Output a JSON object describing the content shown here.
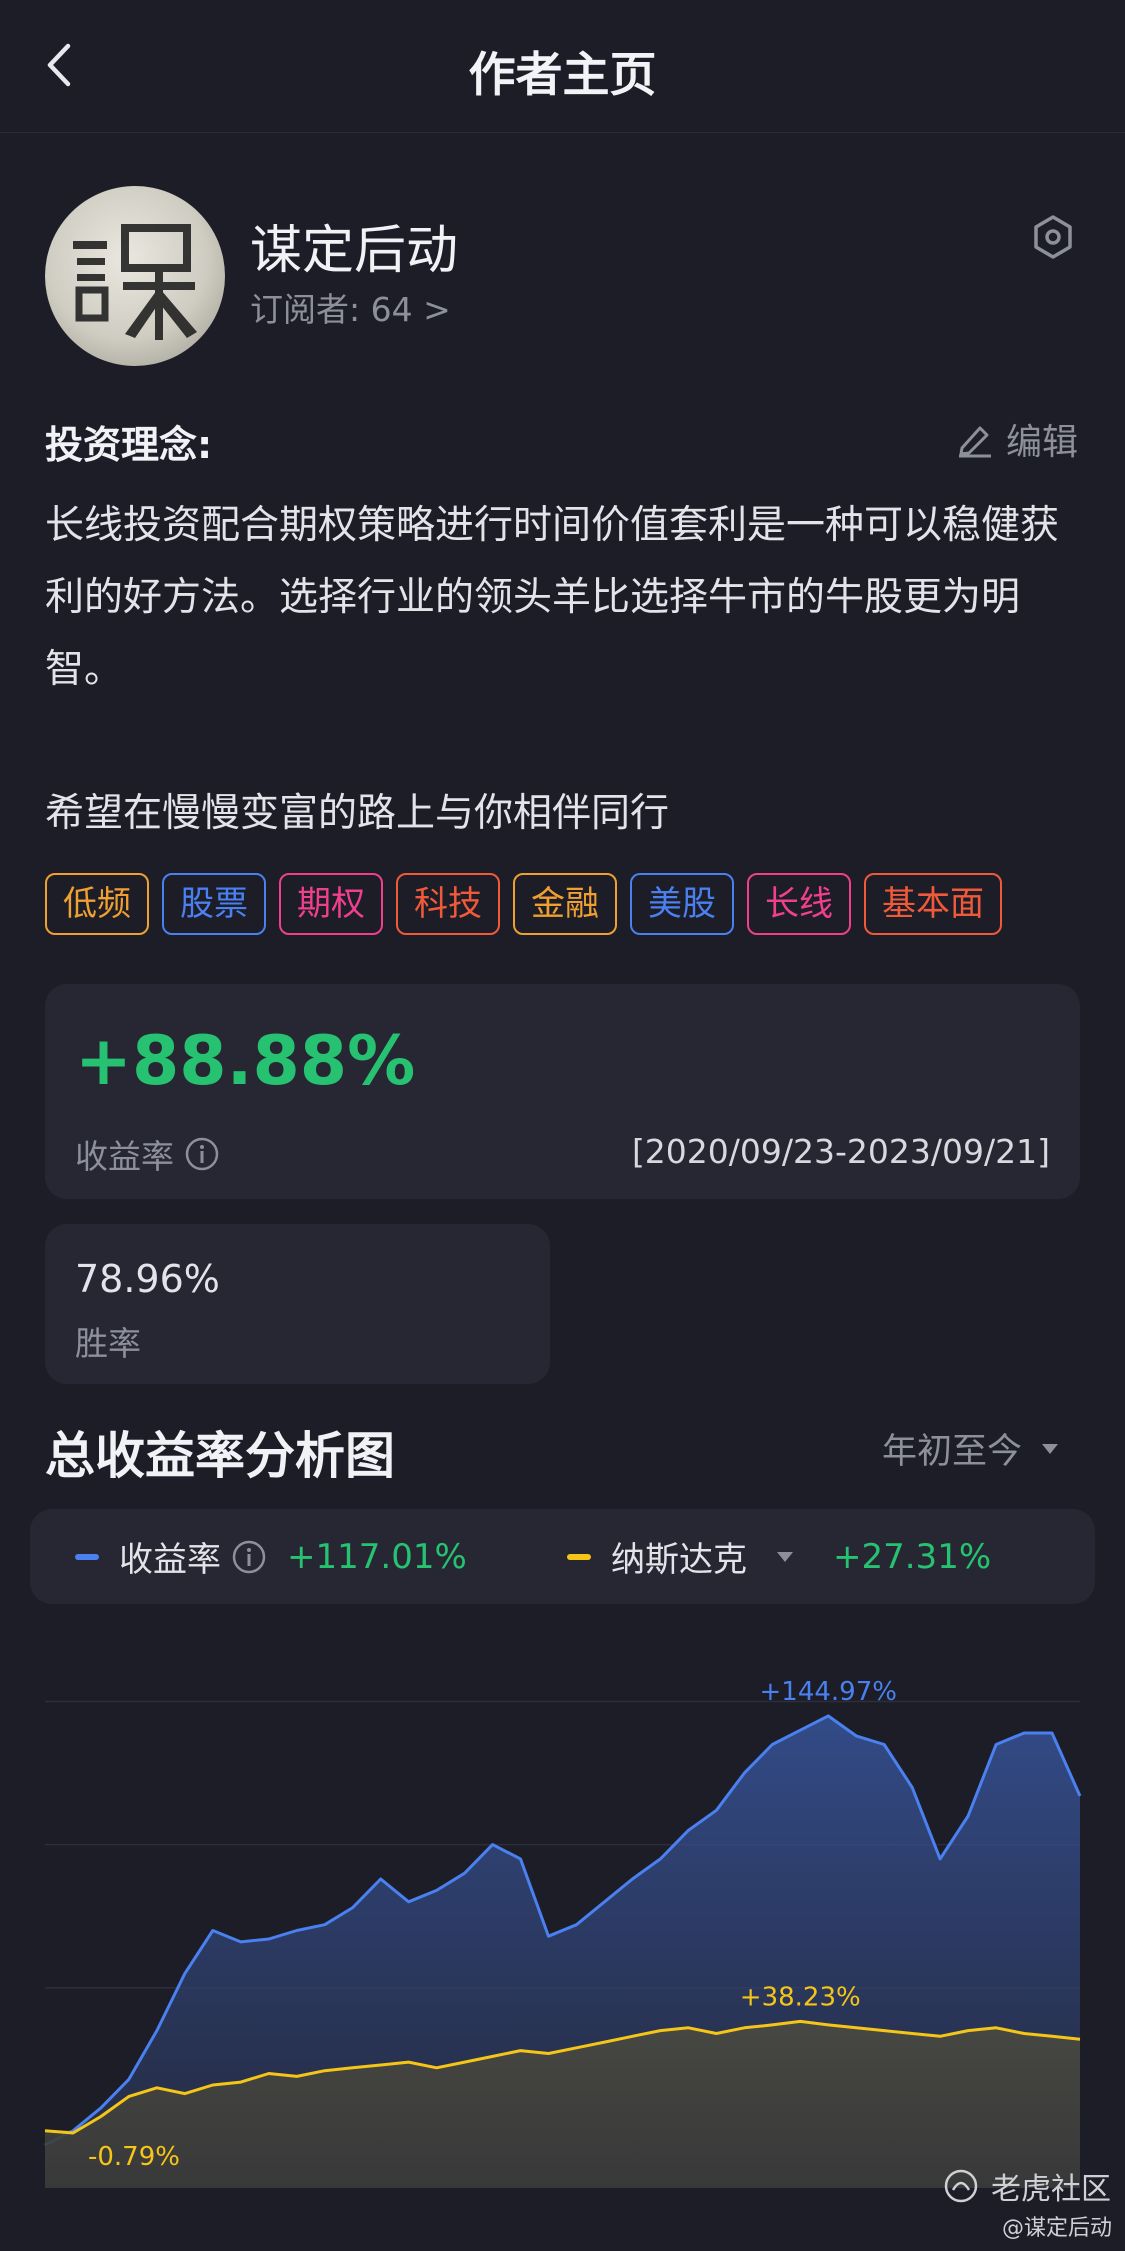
{
  "nav": {
    "title": "作者主页"
  },
  "author": {
    "name": "谋定后动",
    "subscribers": "订阅者: 64 >"
  },
  "philosophy": {
    "label": "投资理念:",
    "edit_label": "编辑",
    "text": "长线投资配合期权策略进行时间价值套利是一种可以稳健获利的好方法。选择行业的领头羊比选择牛市的牛股更为明智。\n\n希望在慢慢变富的路上与你相伴同行"
  },
  "tags": [
    {
      "label": "低频",
      "color": "#f0a030"
    },
    {
      "label": "股票",
      "color": "#4a80f0"
    },
    {
      "label": "期权",
      "color": "#ef3f8d"
    },
    {
      "label": "科技",
      "color": "#f05a3a"
    },
    {
      "label": "金融",
      "color": "#f0a030"
    },
    {
      "label": "美股",
      "color": "#4a80f0"
    },
    {
      "label": "长线",
      "color": "#ef3f8d"
    },
    {
      "label": "基本面",
      "color": "#f05a3a"
    }
  ],
  "stats": {
    "return_value": "+88.88%",
    "return_label": "收益率",
    "return_period": "[2020/09/23-2023/09/21]",
    "win_rate_value": "78.96%",
    "win_rate_label": "胜率"
  },
  "chart_section": {
    "title": "总收益率分析图",
    "range": "年初至今"
  },
  "legend": {
    "series1_name": "收益率",
    "series1_value": "+117.01%",
    "series1_color": "#4a80f0",
    "series2_name": "纳斯达克",
    "series2_value": "+27.31%",
    "series2_color": "#f5c518",
    "positive_color": "#27c271"
  },
  "chart_data": {
    "type": "area",
    "ylim": [
      -20,
      175
    ],
    "grid": true,
    "series": [
      {
        "name": "收益率",
        "color": "#4a80f0",
        "values": [
          -5,
          0,
          8,
          18,
          35,
          55,
          70,
          66,
          67,
          70,
          72,
          78,
          88,
          80,
          84,
          90,
          100,
          95,
          68,
          72,
          80,
          88,
          95,
          105,
          112,
          125,
          135,
          140,
          144.97,
          138,
          135,
          120,
          95,
          110,
          135,
          139,
          139,
          117
        ]
      },
      {
        "name": "纳斯达克",
        "color": "#f5c518",
        "values": [
          0,
          -0.79,
          5,
          12,
          15,
          13,
          16,
          17,
          20,
          19,
          21,
          22,
          23,
          24,
          22,
          24,
          26,
          28,
          27,
          29,
          31,
          33,
          35,
          36,
          34,
          36,
          37,
          38.23,
          37,
          36,
          35,
          34,
          33,
          35,
          36,
          34,
          33,
          32
        ]
      }
    ],
    "annotations": [
      {
        "text": "+144.97%",
        "series": 0,
        "index": 28
      },
      {
        "text": "+38.23%",
        "series": 1,
        "index": 27
      },
      {
        "text": "-0.79%",
        "series": 1,
        "index": 1
      }
    ]
  },
  "watermark": {
    "text": "老虎社区",
    "sub": "@谋定后动"
  }
}
